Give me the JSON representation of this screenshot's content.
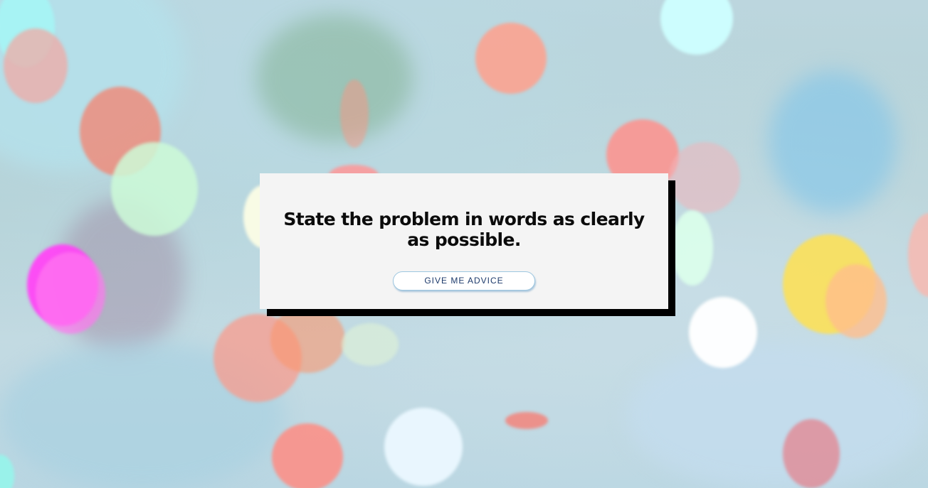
{
  "background": {
    "description_colors": {
      "base": "#bcd6de",
      "bokeh_pink": "#f36f7a",
      "bokeh_magenta": "#ff3df0",
      "bokeh_mint": "#c8f2d8",
      "bokeh_yellow": "#ffe04a",
      "bokeh_cyan": "#c8fbff",
      "bokeh_white": "#ffffff"
    }
  },
  "card": {
    "quote": "State the problem in words as clearly as possible.",
    "button_label": "GIVE ME ADVICE",
    "background_color": "#f4f4f4",
    "shadow_color": "#000000",
    "button_text_color": "#1d3a6b",
    "button_border_color": "#9ec7e0"
  }
}
